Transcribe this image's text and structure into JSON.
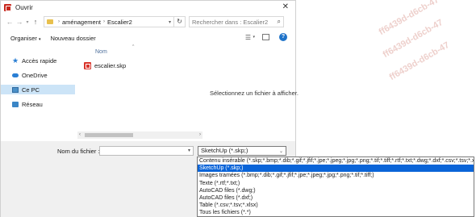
{
  "window": {
    "title": "Ouvrir",
    "close_glyph": "✕"
  },
  "navigation": {
    "breadcrumbs": [
      "aménagement",
      "Escalier2"
    ],
    "search_placeholder": "Rechercher dans : Escalier2"
  },
  "toolbar": {
    "organize_label": "Organiser",
    "new_folder_label": "Nouveau dossier",
    "help_glyph": "?"
  },
  "sidebar": {
    "items": [
      {
        "label": "Accès rapide",
        "icon": "star-icon"
      },
      {
        "label": "OneDrive",
        "icon": "cloud-icon"
      },
      {
        "label": "Ce PC",
        "icon": "computer-icon",
        "selected": true
      },
      {
        "label": "Réseau",
        "icon": "network-icon"
      }
    ]
  },
  "file_list": {
    "column_header": "Nom",
    "files": [
      {
        "name": "escalier.skp",
        "icon": "skp-file-icon"
      }
    ]
  },
  "preview": {
    "message": "Sélectionnez un fichier à afficher."
  },
  "footer": {
    "filename_label": "Nom du fichier :",
    "filename_value": "",
    "file_type_selected": "SketchUp (*.skp;)",
    "file_type_options": [
      "Contenu insérable (*.skp;*.bmp;*.dib;*.gif;*.jfif;*.jpe;*.jpeg;*.jpg;*.png;*.tif;*.tiff;*.rtf;*.txt;*.dwg;*.dxf;*.csv;*.tsv;*.xlsx)",
      "SketchUp (*.skp;)",
      "Images tramées (*.bmp;*.dib;*.gif;*.jfif;*.jpe;*.jpeg;*.jpg;*.png;*.tif;*.tiff;)",
      "Texte (*.rtf;*.txt;)",
      "AutoCAD files (*.dwg;)",
      "AutoCAD files (*.dxf;)",
      "Table (*.csv;*.tsv;*.xlsx)",
      "Tous les fichiers (*.*)"
    ],
    "highlighted_option_index": 1
  },
  "colors": {
    "accent": "#0a64d8",
    "selection": "#cce4f7",
    "help": "#1f73c9"
  }
}
